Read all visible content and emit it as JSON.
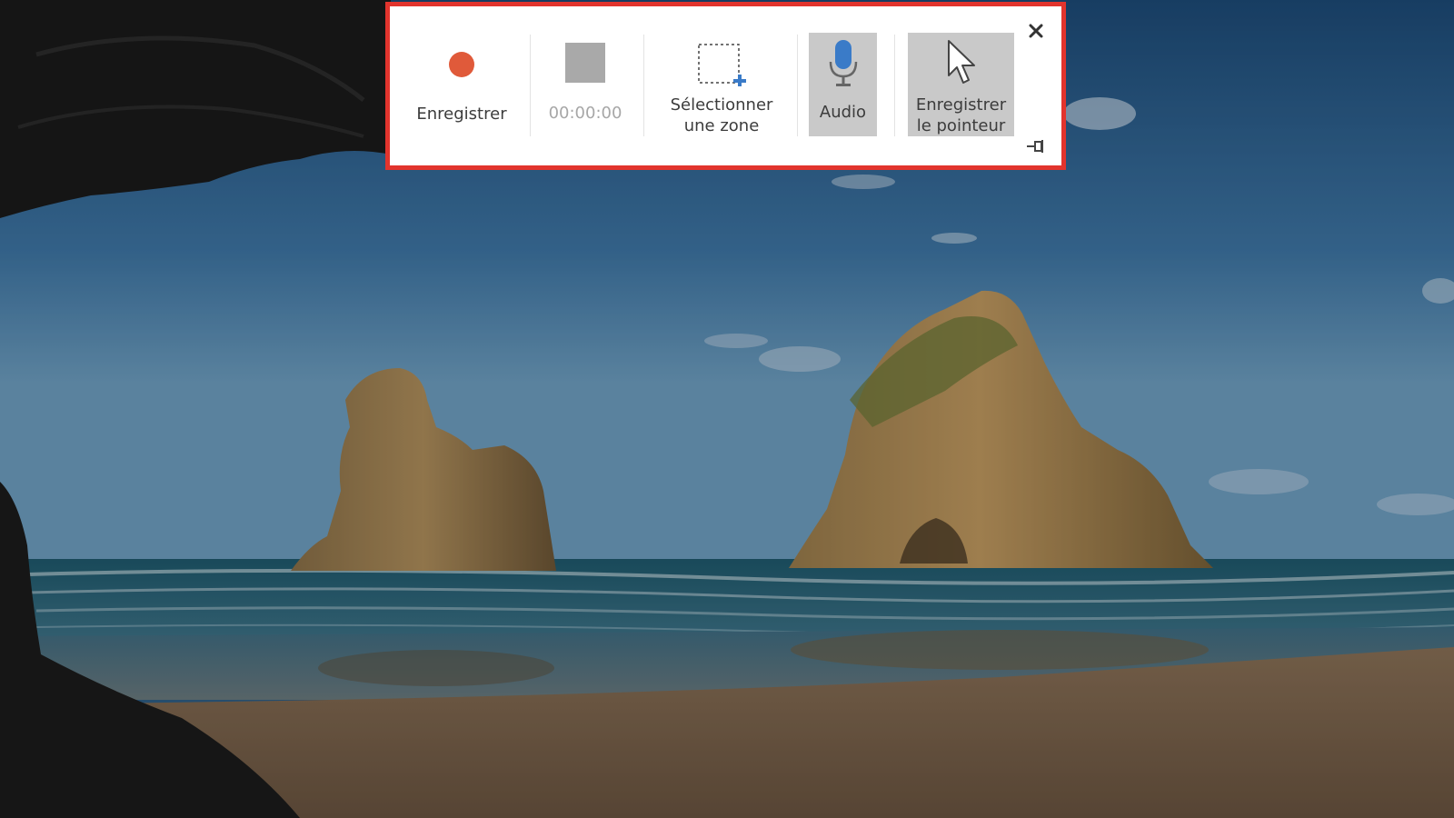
{
  "toolbar": {
    "record_label": "Enregistrer",
    "timer_value": "00:00:00",
    "select_label_line1": "Sélectionner",
    "select_label_line2": "une zone",
    "audio_label": "Audio",
    "pointer_label_line1": "Enregistrer",
    "pointer_label_line2": "le pointeur",
    "close_icon": "close-icon",
    "pin_icon": "pin-icon"
  },
  "colors": {
    "highlight_border": "#e2342d",
    "record_dot": "#e05a3a",
    "toggle_active_bg": "#c9c9c9",
    "accent_blue": "#3a7bc8"
  },
  "state": {
    "audio_enabled": true,
    "record_pointer_enabled": true
  }
}
